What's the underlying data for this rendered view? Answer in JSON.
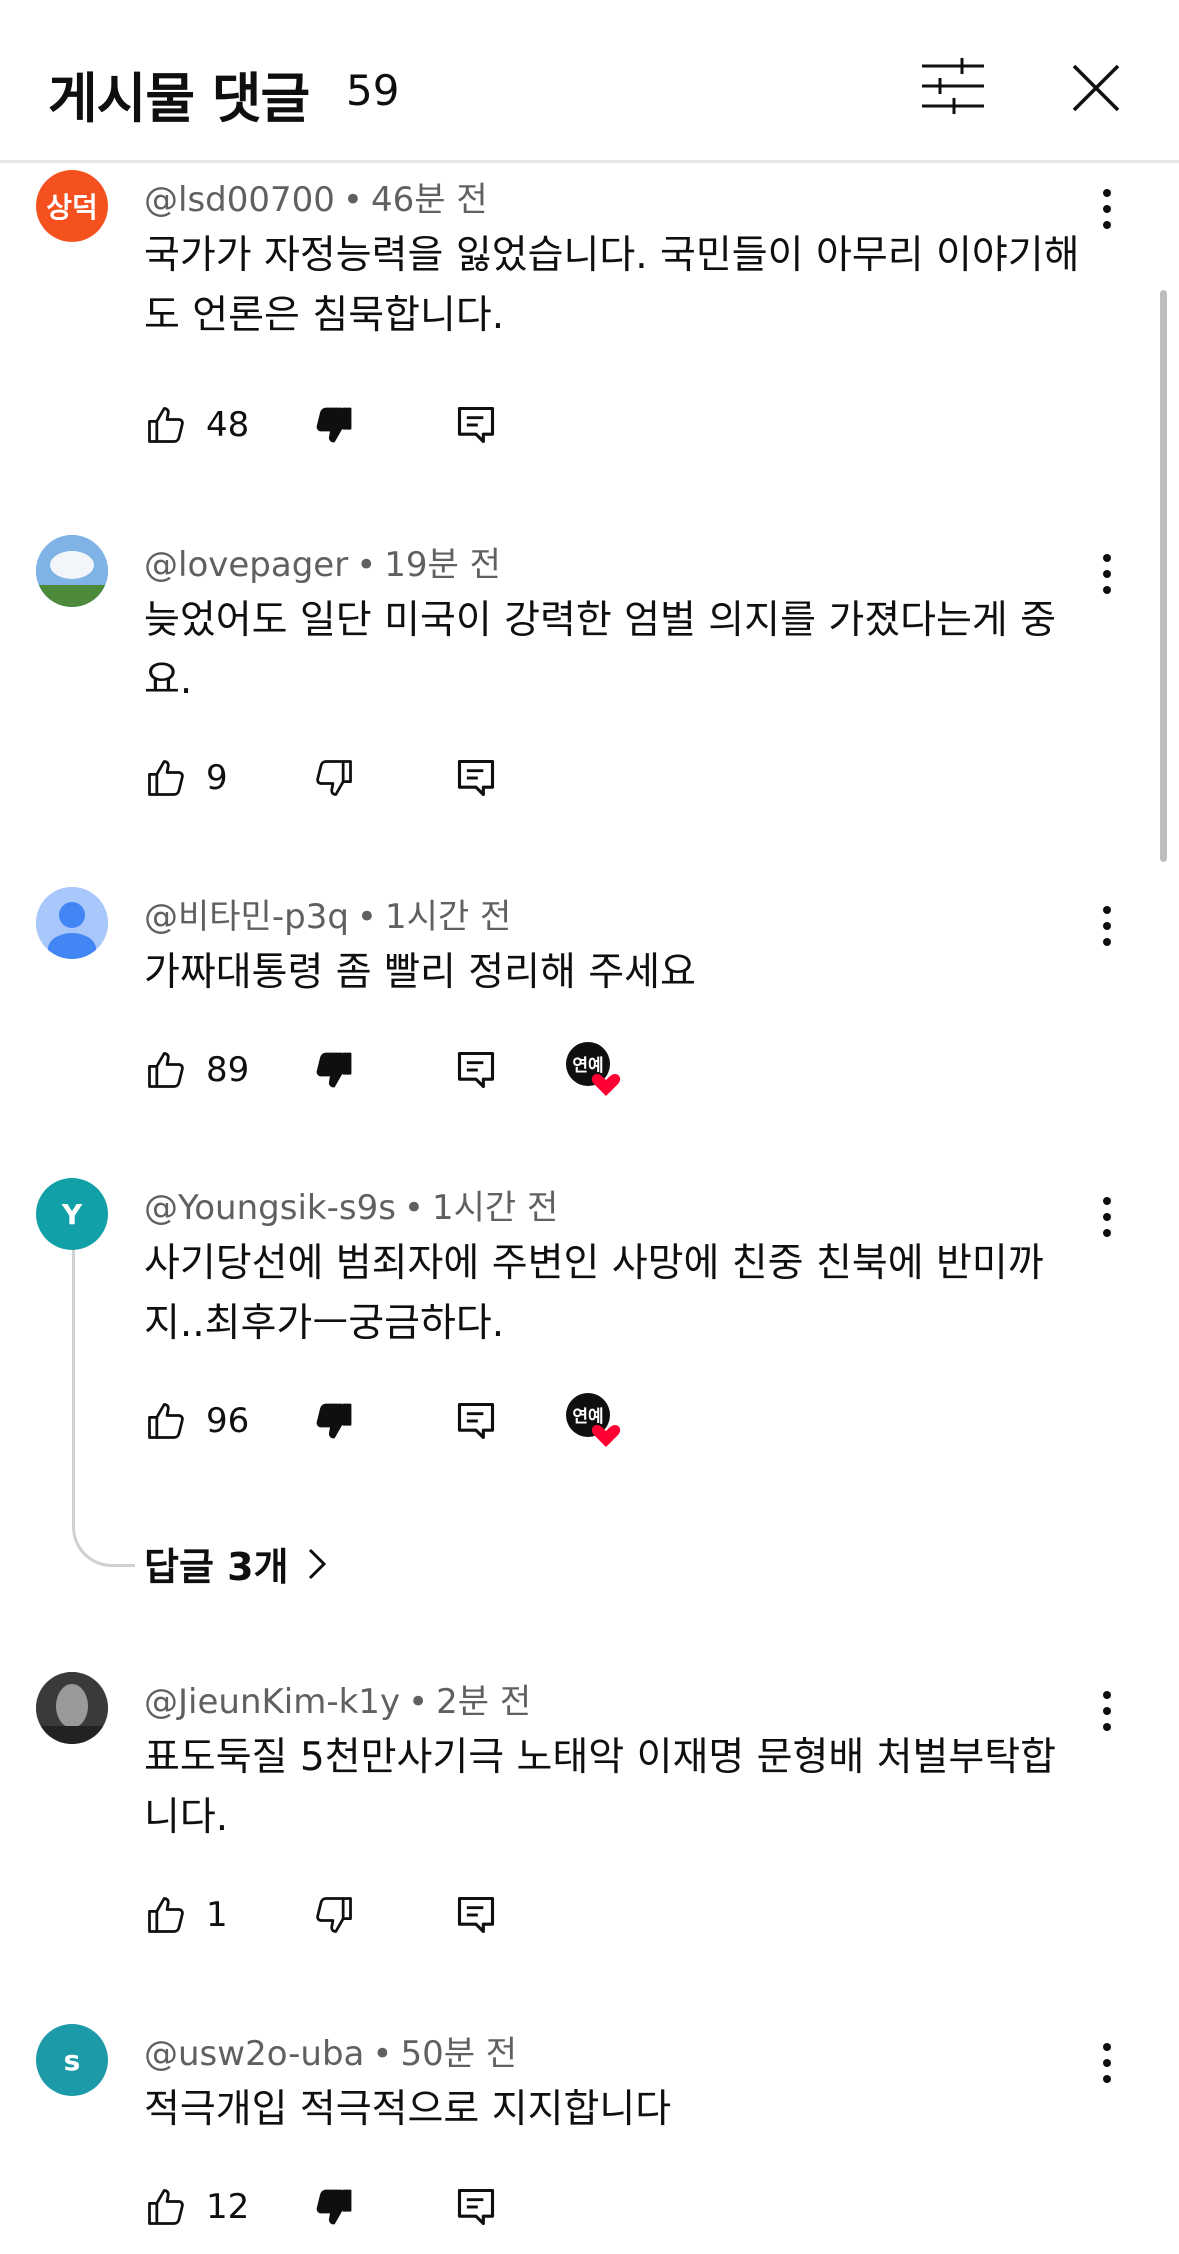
{
  "header": {
    "title": "게시물 댓글",
    "count": "59"
  },
  "comments": [
    {
      "author": "@lsd00700",
      "time": "46분 전",
      "text": "국가가 자정능력을 잃었습니다. 국민들이 아무리 이야기해도 언론은 침묵합니다.",
      "likes": "48",
      "avatar_text": "상덕",
      "avatar_color": "#f4511e",
      "disliked": true,
      "creator_heart": false
    },
    {
      "author": "@lovepager",
      "time": "19분 전",
      "text": "늦었어도 일단 미국이 강력한 엄벌 의지를 가졌다는게 중요.",
      "likes": "9",
      "avatar_text": "",
      "avatar_color": "#6fa8dc",
      "disliked": false,
      "creator_heart": false
    },
    {
      "author": "@비타민-p3q",
      "time": "1시간 전",
      "text": "가짜대통령 좀 빨리  정리해 주세요",
      "likes": "89",
      "avatar_text": "",
      "avatar_color": "#a8c7fa",
      "disliked": true,
      "creator_heart": true
    },
    {
      "author": "@Youngsik-s9s",
      "time": "1시간 전",
      "text": "사기당선에 범죄자에 주변인 사망에 친중 친북에 반미까지..최후가ㅡ궁금하다.",
      "likes": "96",
      "avatar_text": "Y",
      "avatar_color": "#12a0a8",
      "disliked": true,
      "creator_heart": true
    },
    {
      "author": "@JieunKim-k1y",
      "time": "2분 전",
      "text": "표도둑질 5천만사기극 노태악 이재명 문형배 처벌부탁합니다.",
      "likes": "1",
      "avatar_text": "",
      "avatar_color": "#555555",
      "disliked": false,
      "creator_heart": false
    },
    {
      "author": "@usw2o-uba",
      "time": "50분 전",
      "text": "적극개입 적극적으로 지지합니다",
      "likes": "12",
      "avatar_text": "s",
      "avatar_color": "#1c9aa8",
      "disliked": true,
      "creator_heart": false
    }
  ],
  "replies_label": "답글 3개",
  "badge_text": "연예",
  "colors": {
    "heart": "#ff0033",
    "badge_bg": "#0f0f0f"
  }
}
